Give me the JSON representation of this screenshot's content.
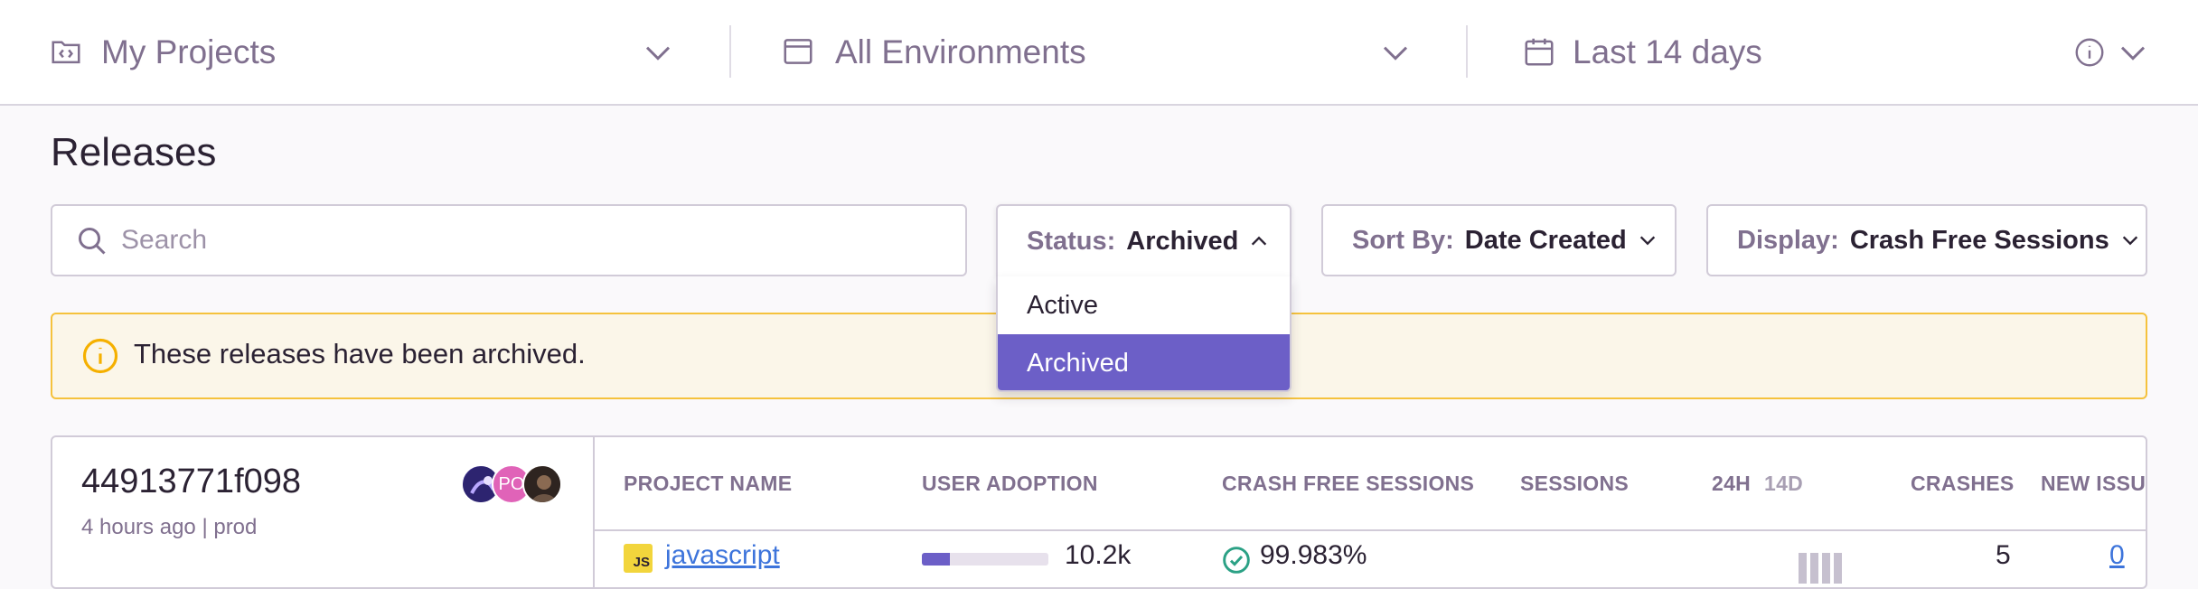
{
  "topbar": {
    "projects_label": "My Projects",
    "environments_label": "All Environments",
    "period_label": "Last 14 days"
  },
  "page": {
    "title": "Releases"
  },
  "search": {
    "placeholder": "Search",
    "value": ""
  },
  "filters": {
    "status": {
      "prefix": "Status:",
      "value": "Archived",
      "expanded": true
    },
    "sort": {
      "prefix": "Sort By:",
      "value": "Date Created"
    },
    "display": {
      "prefix": "Display:",
      "value": "Crash Free Sessions"
    }
  },
  "status_menu": {
    "options": [
      {
        "label": "Active",
        "selected": false
      },
      {
        "label": "Archived",
        "selected": true
      }
    ]
  },
  "alert": {
    "text": "These releases have been archived."
  },
  "release": {
    "version": "44913771f098",
    "time_ago": "4 hours ago",
    "separator": "|",
    "environment": "prod",
    "avatars": [
      {
        "initials": "",
        "color": "#3b2f8f"
      },
      {
        "initials": "PO",
        "color": "#e063b8"
      },
      {
        "initials": "",
        "color": "#4a3a30"
      }
    ],
    "columns": {
      "project_name": "PROJECT NAME",
      "user_adoption": "USER ADOPTION",
      "crash_free_sessions": "CRASH FREE SESSIONS",
      "sessions": "SESSIONS",
      "period_24h": "24H",
      "period_14d": "14D",
      "crashes": "CRASHES",
      "new_issues": "NEW ISSUES"
    },
    "row": {
      "platform_badge": "JS",
      "project": "javascript",
      "adoption_fraction": 0.22,
      "adoption_count": "10.2k",
      "crash_free": "99.983%",
      "crashes": "5",
      "new_issues": "0"
    }
  },
  "colors": {
    "accent": "#6c5fc7",
    "link": "#3d74db",
    "warning_border": "#f5c23d",
    "warning_bg": "#fbf6e9",
    "success": "#2ba185"
  },
  "icons": {
    "projects": "project-folder-icon",
    "environments": "window-icon",
    "period": "calendar-icon",
    "info": "info-icon",
    "search": "search-icon",
    "alert": "warning-info-icon",
    "crash_free": "check-circle-icon"
  }
}
